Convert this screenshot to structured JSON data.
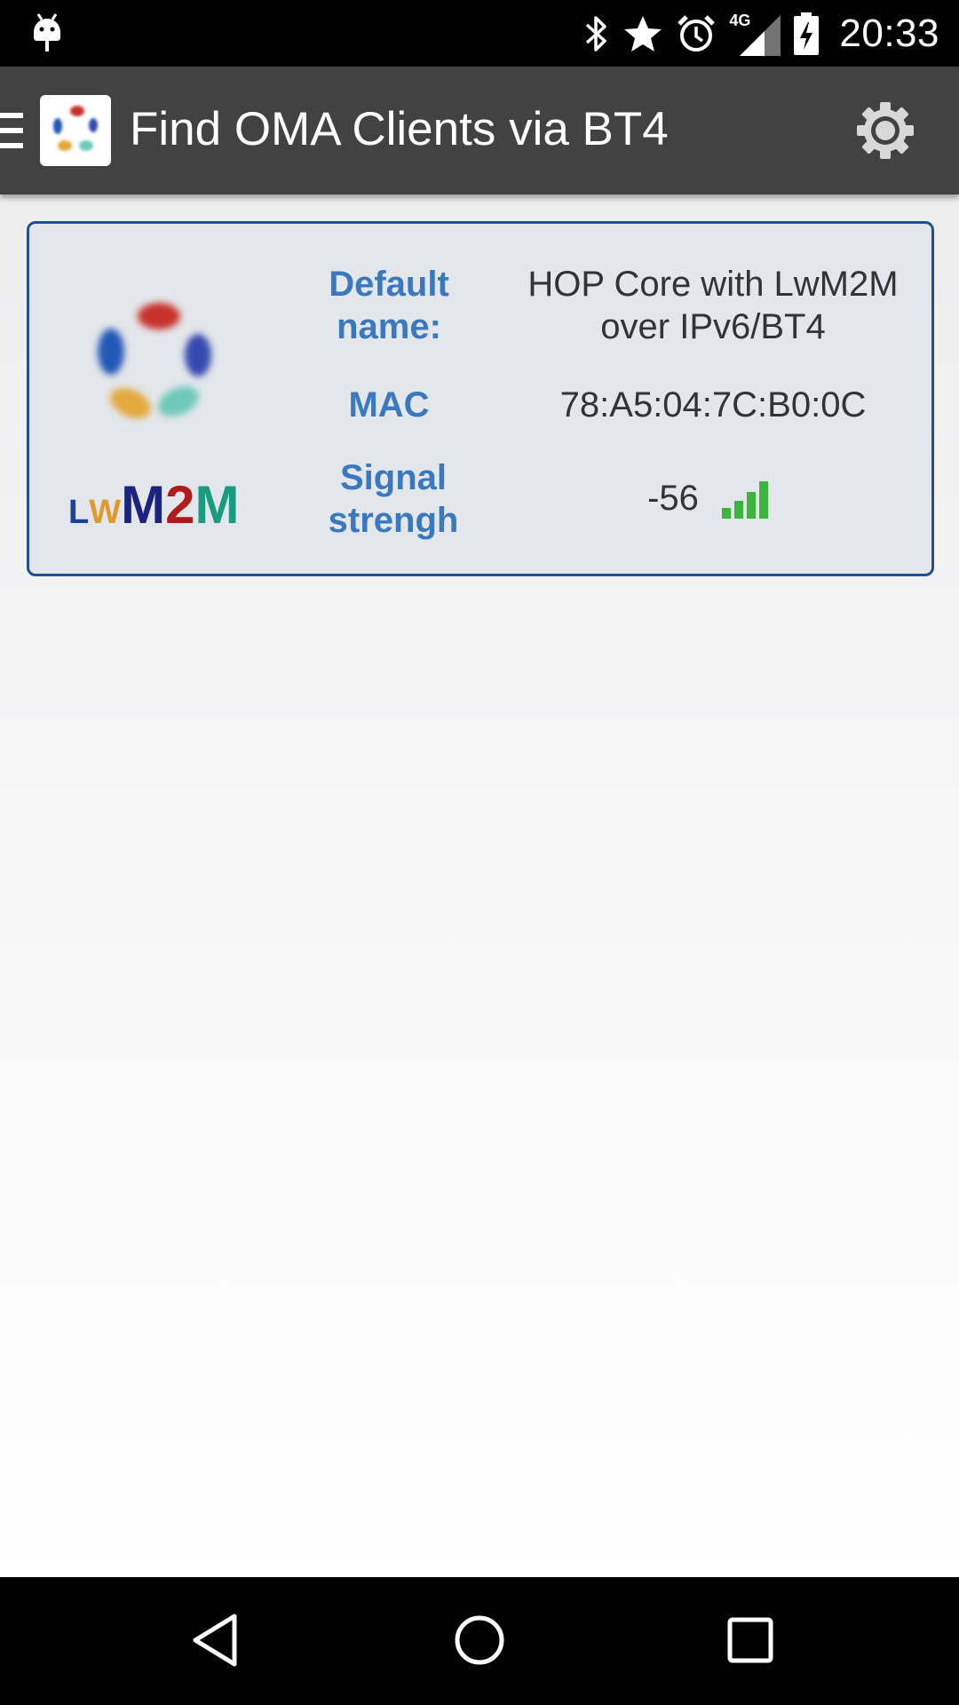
{
  "status_bar": {
    "network": "4G",
    "time": "20:33",
    "icons": [
      "android-debug-icon",
      "bluetooth-icon",
      "star-icon",
      "alarm-icon",
      "signal-icon",
      "battery-charging-icon"
    ]
  },
  "toolbar": {
    "title": "Find OMA Clients via BT4",
    "icons": [
      "menu-icon",
      "app-icon",
      "settings-icon"
    ]
  },
  "device_card": {
    "logo_text": {
      "l": "L",
      "w": "W",
      "m1": "M",
      "two": "2",
      "m2": "M"
    },
    "default_name_label_1": "Default",
    "default_name_label_2": "name:",
    "default_name_value_1": "HOP Core with LwM2M",
    "default_name_value_2": "over IPv6/BT4",
    "mac_label": "MAC",
    "mac_value": "78:A5:04:7C:B0:0C",
    "signal_label_1": "Signal",
    "signal_label_2": "strengh",
    "signal_value": "-56",
    "signal_level": 4
  },
  "colors": {
    "label": "#3a78bf",
    "card_border": "#1f4f95",
    "signal_green": "#3cb53c",
    "toolbar": "#424242"
  }
}
